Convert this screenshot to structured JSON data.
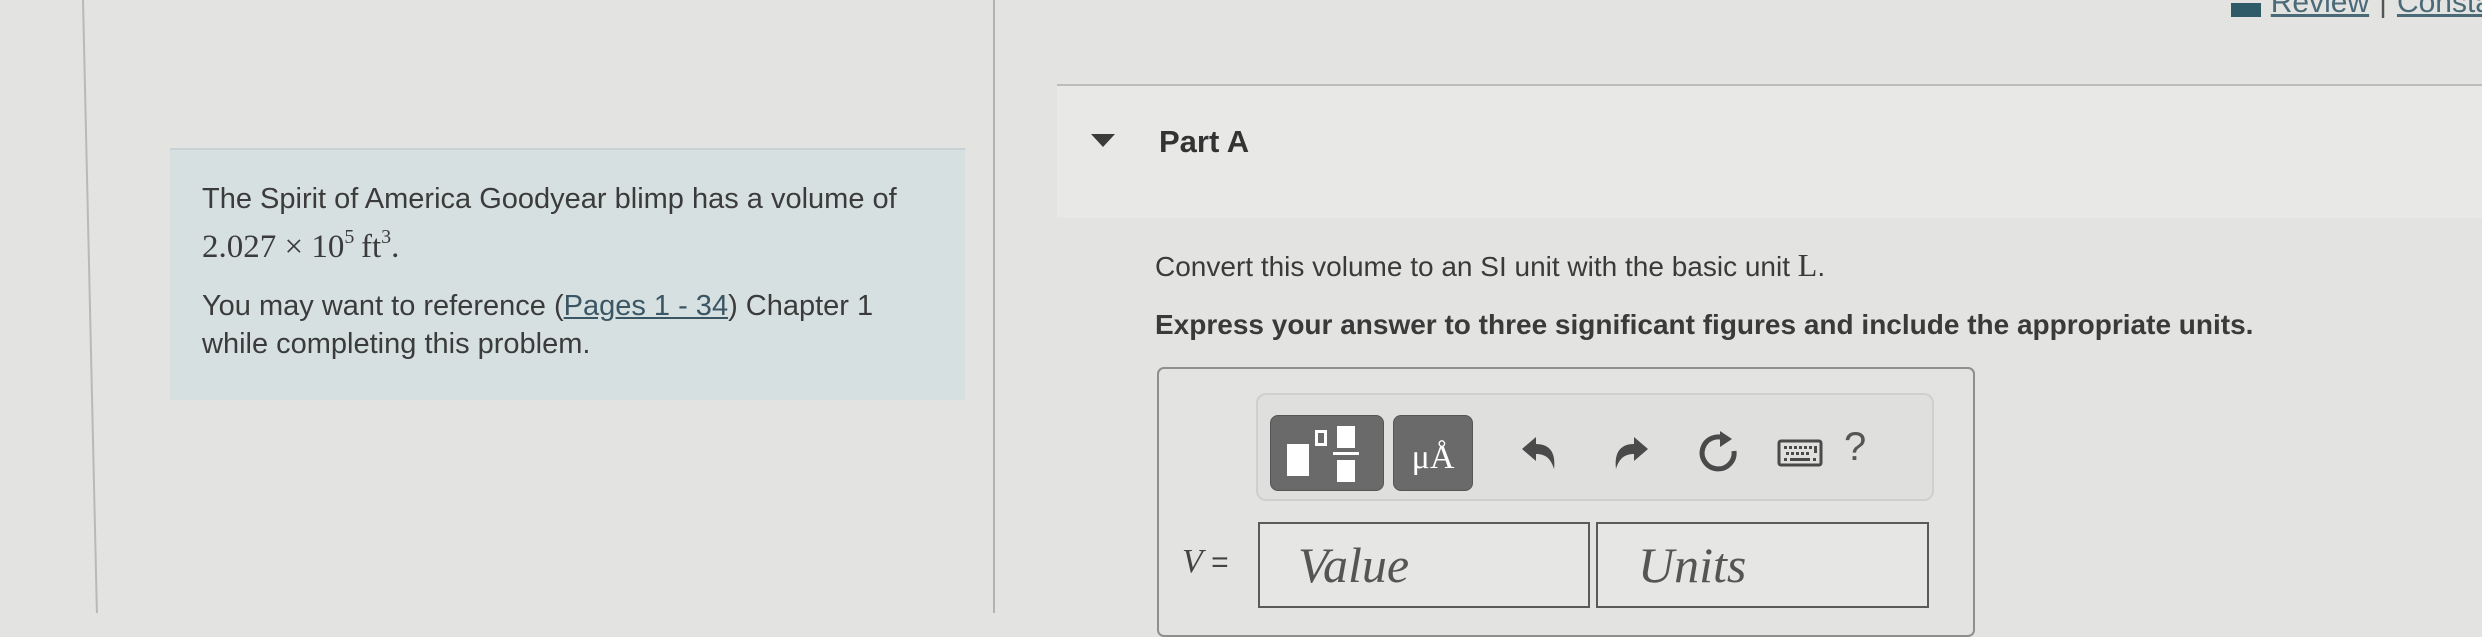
{
  "top_links": {
    "icon": "review-icon",
    "review_label": "Review",
    "separator": "|",
    "constants_label": "Consta"
  },
  "problem": {
    "intro_text": "The Spirit of America Goodyear blimp has a volume of",
    "volume_math": "2.027 × 10",
    "volume_exponent": "5",
    "volume_unit": "ft",
    "volume_unit_exponent": "3",
    "period": ".",
    "reference_prefix": "You may want to reference (",
    "reference_link": "Pages 1 - 34",
    "reference_suffix": ") Chapter 1 while completing this problem."
  },
  "part": {
    "toggle_icon": "triangle-down-icon",
    "title": "Part A",
    "instruction": "Convert this volume to an SI unit with the basic unit",
    "instruction_unit": "L",
    "instruction_end": ".",
    "bold_instruction": "Express your answer to three significant figures and include the appropriate units."
  },
  "toolbar": {
    "templates_icon": "templates-icon",
    "units_label": "μÅ",
    "undo_icon": "undo-icon",
    "redo_icon": "redo-icon",
    "reset_icon": "reset-icon",
    "keyboard_icon": "keyboard-icon",
    "help_label": "?"
  },
  "answer": {
    "variable": "V",
    "equals": "=",
    "value_placeholder": "Value",
    "value": "",
    "units_placeholder": "Units",
    "units": ""
  }
}
